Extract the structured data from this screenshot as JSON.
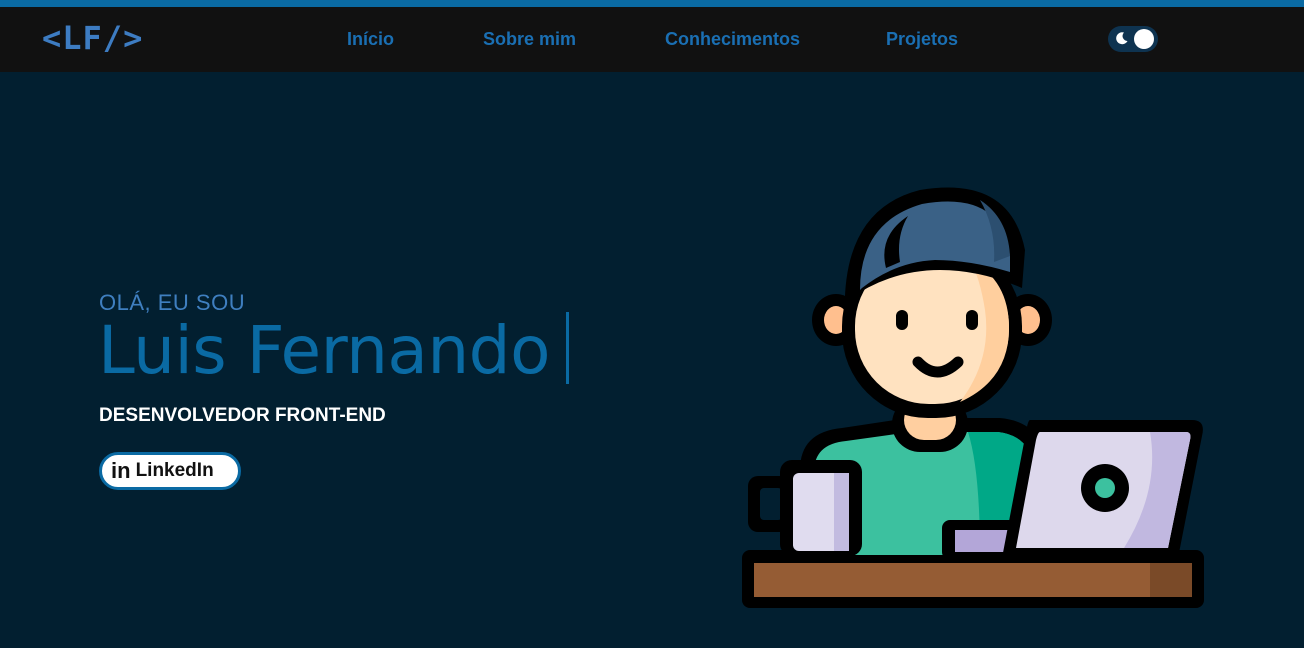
{
  "header": {
    "logo": "<LF/>",
    "nav": [
      {
        "label": "Início"
      },
      {
        "label": "Sobre mim"
      },
      {
        "label": "Conhecimentos"
      },
      {
        "label": "Projetos"
      }
    ],
    "theme_toggle": {
      "state": "dark",
      "icon": "moon-icon"
    }
  },
  "hero": {
    "greeting": "OLÁ, EU SOU",
    "name": "Luis Fernando",
    "role": "DESENVOLVEDOR FRONT-END",
    "linkedin_button": {
      "icon": "in",
      "label": "LinkedIn"
    }
  },
  "colors": {
    "background": "#021f30",
    "navbar": "#111111",
    "accent": "#0a6aa3",
    "greeting": "#3f7fc0"
  }
}
